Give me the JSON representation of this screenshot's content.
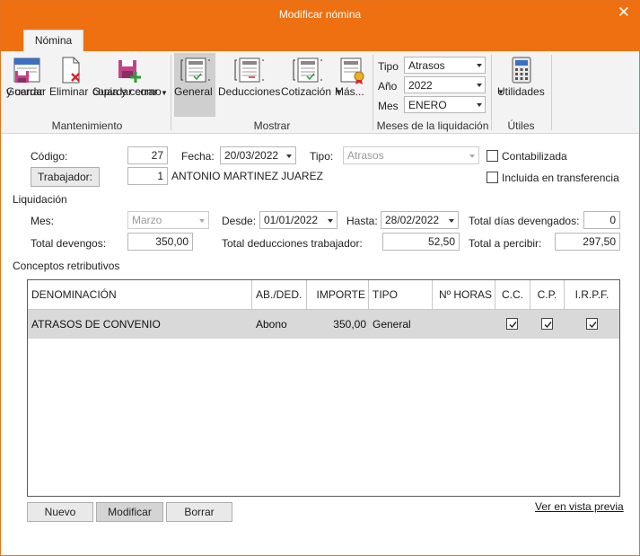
{
  "window": {
    "title": "Modificar nómina",
    "close_glyph": "✕"
  },
  "ribbon": {
    "tab": "Nómina",
    "buttons": {
      "guardar_line1": "Guardar",
      "guardar_line2": "y cerrar",
      "eliminar": "Eliminar",
      "copia_line1": "Guardar como",
      "copia_line2": "copia y cerrar",
      "general": "General",
      "deducciones": "Deducciones",
      "cotizacion": "Cotización",
      "mas": "Más...",
      "utilidades": "Utilidades"
    },
    "groups": {
      "mantenimiento": "Mantenimiento",
      "mostrar": "Mostrar",
      "meses": "Meses de la liquidación",
      "utiles": "Útiles"
    },
    "tipo": {
      "label": "Tipo",
      "value": "Atrasos"
    },
    "anio": {
      "label": "Año",
      "value": "2022"
    },
    "mes": {
      "label": "Mes",
      "value": "ENERO"
    }
  },
  "form": {
    "codigo": {
      "label": "Código:",
      "value": "27"
    },
    "fecha": {
      "label": "Fecha:",
      "value": "20/03/2022"
    },
    "tipo": {
      "label": "Tipo:",
      "value": "Atrasos"
    },
    "contabilizada": {
      "label": "Contabilizada",
      "checked": false
    },
    "trabajador": {
      "button": "Trabajador:",
      "id": "1",
      "name": "ANTONIO MARTINEZ JUAREZ"
    },
    "incluida": {
      "label": "Incluida en transferencia",
      "checked": false
    }
  },
  "liquidacion": {
    "section": "Liquidación",
    "mes": {
      "label": "Mes:",
      "value": "Marzo"
    },
    "desde": {
      "label": "Desde:",
      "value": "01/01/2022"
    },
    "hasta": {
      "label": "Hasta:",
      "value": "28/02/2022"
    },
    "dias": {
      "label": "Total días devengados:",
      "value": "0"
    },
    "devengos": {
      "label": "Total devengos:",
      "value": "350,00"
    },
    "deducciones": {
      "label": "Total deducciones trabajador:",
      "value": "52,50"
    },
    "percibir": {
      "label": "Total a percibir:",
      "value": "297,50"
    }
  },
  "conceptos": {
    "section": "Conceptos retributivos",
    "columns": [
      "DENOMINACIÓN",
      "AB./DED.",
      "IMPORTE",
      "TIPO",
      "Nº HORAS",
      "C.C.",
      "C.P.",
      "I.R.P.F."
    ],
    "rows": [
      {
        "denominacion": "ATRASOS DE CONVENIO",
        "ab_ded": "Abono",
        "importe": "350,00",
        "tipo": "General",
        "horas": "",
        "cc": true,
        "cp": true,
        "irpf": true
      }
    ]
  },
  "actions": {
    "nuevo": "Nuevo",
    "modificar": "Modificar",
    "borrar": "Borrar",
    "vista_previa": "Ver en vista previa"
  },
  "colors": {
    "accent": "#ee7011",
    "ribbon_bg": "#f3f3f3",
    "selected_row": "#d9d9d9"
  },
  "icons": {
    "guardar": "save-close-icon",
    "eliminar": "delete-document-icon",
    "copia": "save-copy-icon",
    "general": "general-view-icon",
    "deducciones": "deductions-view-icon",
    "cotizacion": "contribution-view-icon",
    "mas": "more-views-icon",
    "utilidades": "calculator-icon"
  }
}
